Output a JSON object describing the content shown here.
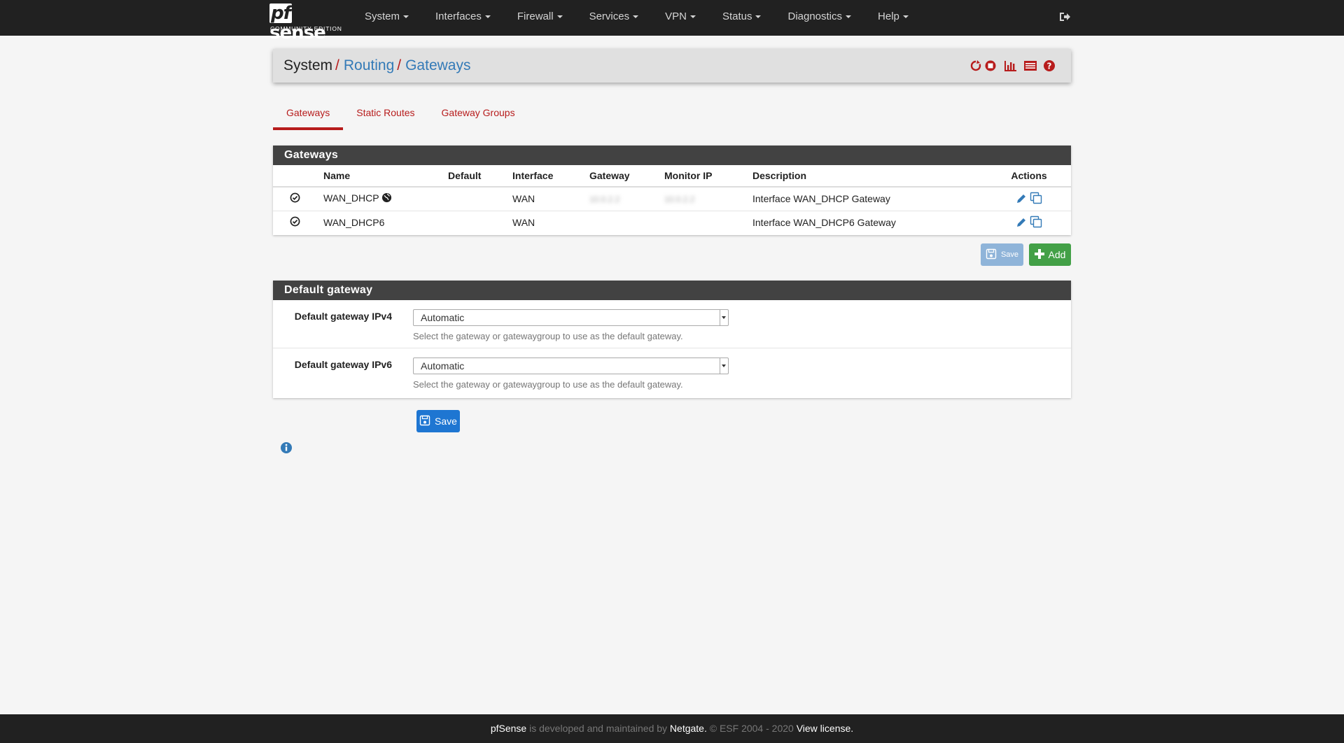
{
  "brand": {
    "logo_prefix": "pf",
    "logo_suffix": "sense",
    "subtitle": "COMMUNITY EDITION"
  },
  "nav": {
    "items": [
      {
        "label": "System"
      },
      {
        "label": "Interfaces"
      },
      {
        "label": "Firewall"
      },
      {
        "label": "Services"
      },
      {
        "label": "VPN"
      },
      {
        "label": "Status"
      },
      {
        "label": "Diagnostics"
      },
      {
        "label": "Help"
      }
    ]
  },
  "breadcrumb": {
    "root": "System",
    "sep": "/",
    "level1": "Routing",
    "level2": "Gateways"
  },
  "tabs": [
    {
      "label": "Gateways"
    },
    {
      "label": "Static Routes"
    },
    {
      "label": "Gateway Groups"
    }
  ],
  "gateways_panel": {
    "title": "Gateways",
    "columns": [
      "",
      "Name",
      "Default",
      "Interface",
      "Gateway",
      "Monitor IP",
      "Description",
      "Actions"
    ],
    "rows": [
      {
        "name": "WAN_DHCP",
        "default": "",
        "interface": "WAN",
        "gateway": "10.0.2.2",
        "monitor_ip": "10.0.2.2",
        "description": "Interface WAN_DHCP Gateway"
      },
      {
        "name": "WAN_DHCP6",
        "default": "",
        "interface": "WAN",
        "gateway": "",
        "monitor_ip": "",
        "description": "Interface WAN_DHCP6 Gateway"
      }
    ],
    "save_label": "Save",
    "add_label": "Add"
  },
  "default_gateway_panel": {
    "title": "Default gateway",
    "ipv4": {
      "label": "Default gateway IPv4",
      "value": "Automatic",
      "help": "Select the gateway or gatewaygroup to use as the default gateway."
    },
    "ipv6": {
      "label": "Default gateway IPv6",
      "value": "Automatic",
      "help": "Select the gateway or gatewaygroup to use as the default gateway."
    }
  },
  "save_button": "Save",
  "footer": {
    "brand": "pfSense",
    "text1": " is developed and maintained by ",
    "company": "Netgate.",
    "text2": " © ESF 2004 - 2020 ",
    "license": "View license."
  },
  "colors": {
    "navbar": "#212121",
    "accent_red": "#b71c1c",
    "link_blue": "#337ab7",
    "panel_heading": "#424242",
    "add_green": "#43a047",
    "save_blue": "#1e76d2"
  }
}
